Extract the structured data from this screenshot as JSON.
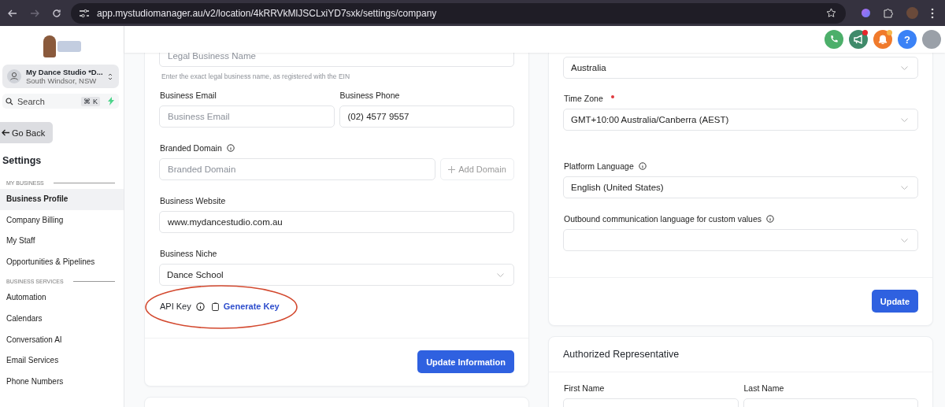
{
  "browser": {
    "url": "app.mystudiomanager.au/v2/location/4kRRVkMlJSCLxiYD7sxk/settings/company"
  },
  "header_actions": [
    {
      "kind": "phone",
      "color": "#4caf6a",
      "unread": false
    },
    {
      "kind": "megaphone",
      "color": "#3f8a6a",
      "unread": true
    },
    {
      "kind": "bell",
      "color": "#f07a2b",
      "unread": true
    },
    {
      "kind": "help",
      "color": "#3b82f6",
      "unread": false,
      "label": "?"
    }
  ],
  "sidebar": {
    "account": {
      "name": "My Dance Studio *D...",
      "location": "South Windsor, NSW"
    },
    "search": {
      "placeholder": "Search",
      "shortcut": "⌘ K"
    },
    "back": "Go Back",
    "title": "Settings",
    "sections": [
      {
        "heading": "MY BUSINESS",
        "items": [
          {
            "label": "Business Profile",
            "selected": true
          },
          {
            "label": "Company Billing",
            "selected": false
          },
          {
            "label": "My Staff",
            "selected": false
          },
          {
            "label": "Opportunities & Pipelines",
            "selected": false
          }
        ]
      },
      {
        "heading": "BUSINESS SERVICES",
        "items": [
          {
            "label": "Automation",
            "selected": false
          },
          {
            "label": "Calendars",
            "selected": false
          },
          {
            "label": "Conversation AI",
            "selected": false
          },
          {
            "label": "Email Services",
            "selected": false
          },
          {
            "label": "Phone Numbers",
            "selected": false
          }
        ]
      }
    ]
  },
  "business_card": {
    "legal_name": {
      "placeholder": "Legal Business Name",
      "hint": "Enter the exact legal business name, as registered with the EIN"
    },
    "email": {
      "label": "Business Email",
      "placeholder": "Business Email"
    },
    "phone": {
      "label": "Business Phone",
      "value": "(02) 4577 9557"
    },
    "branded_domain": {
      "label": "Branded Domain",
      "placeholder": "Branded Domain",
      "button": "Add Domain"
    },
    "website": {
      "label": "Business Website",
      "value": "www.mydancestudio.com.au"
    },
    "niche": {
      "label": "Business Niche",
      "value": "Dance School"
    },
    "api_key": {
      "label": "API Key",
      "link": "Generate Key"
    },
    "button": "Update Information"
  },
  "general_card": {
    "country": {
      "value": "Australia"
    },
    "time_zone": {
      "label": "Time Zone",
      "required": true,
      "value": "GMT+10:00 Australia/Canberra (AEST)"
    },
    "platform_language": {
      "label": "Platform Language",
      "value": "English (United States)"
    },
    "outbound_language": {
      "label": "Outbound communication language for custom values"
    },
    "button": "Update"
  },
  "representative_card": {
    "title": "Authorized Representative",
    "first_name": {
      "label": "First Name"
    },
    "last_name": {
      "label": "Last Name"
    }
  }
}
